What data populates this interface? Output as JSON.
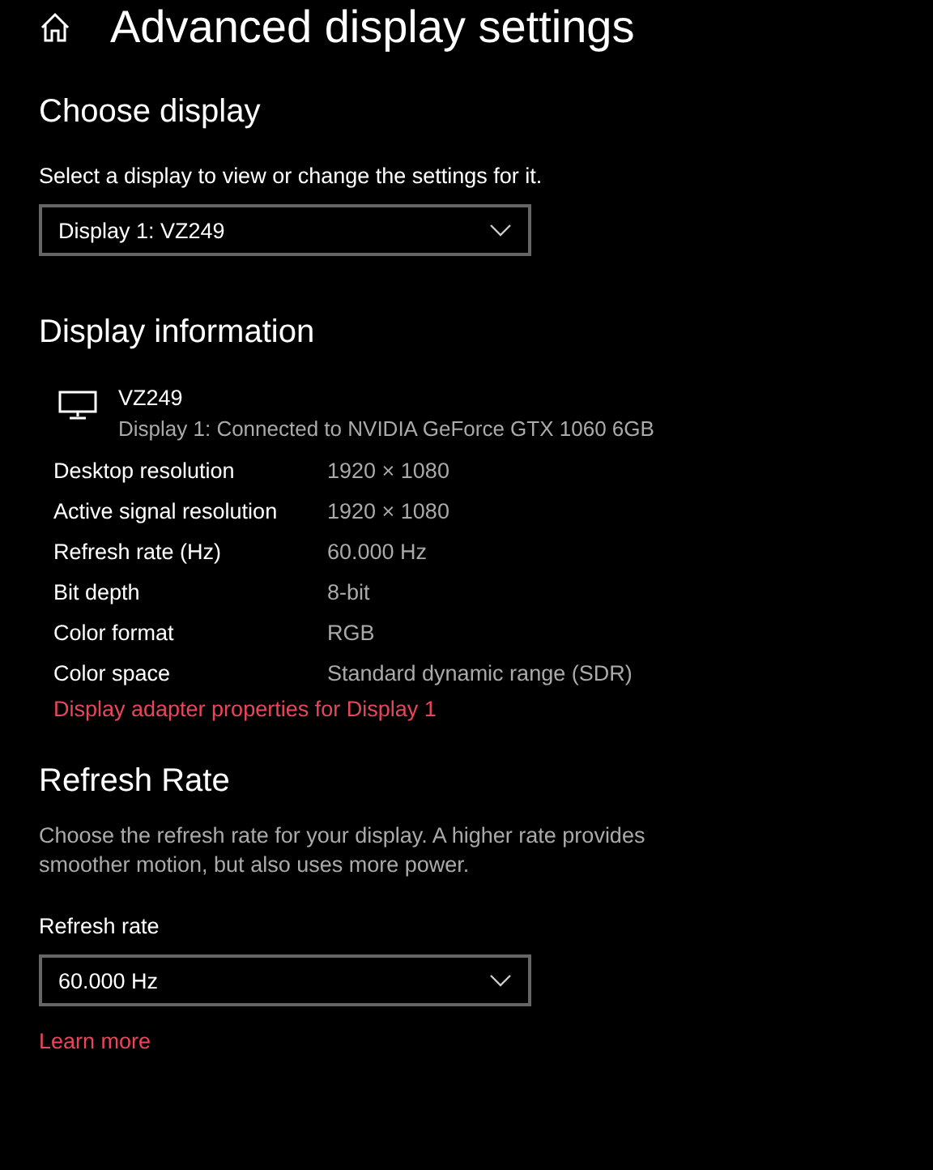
{
  "header": {
    "title": "Advanced display settings"
  },
  "choose_display": {
    "heading": "Choose display",
    "label": "Select a display to view or change the settings for it.",
    "dropdown": {
      "value": "Display 1: VZ249"
    }
  },
  "display_information": {
    "heading": "Display information",
    "monitor": {
      "name": "VZ249",
      "description": "Display 1: Connected to NVIDIA GeForce GTX 1060 6GB"
    },
    "rows": [
      {
        "label": "Desktop resolution",
        "value": "1920 × 1080"
      },
      {
        "label": "Active signal resolution",
        "value": "1920 × 1080"
      },
      {
        "label": "Refresh rate (Hz)",
        "value": "60.000 Hz"
      },
      {
        "label": "Bit depth",
        "value": "8-bit"
      },
      {
        "label": "Color format",
        "value": "RGB"
      },
      {
        "label": "Color space",
        "value": "Standard dynamic range (SDR)"
      }
    ],
    "link": "Display adapter properties for Display 1"
  },
  "refresh_rate": {
    "heading": "Refresh Rate",
    "description": "Choose the refresh rate for your display. A higher rate provides smoother motion, but also uses more power.",
    "label": "Refresh rate",
    "dropdown": {
      "value": "60.000 Hz"
    },
    "link": "Learn more"
  }
}
